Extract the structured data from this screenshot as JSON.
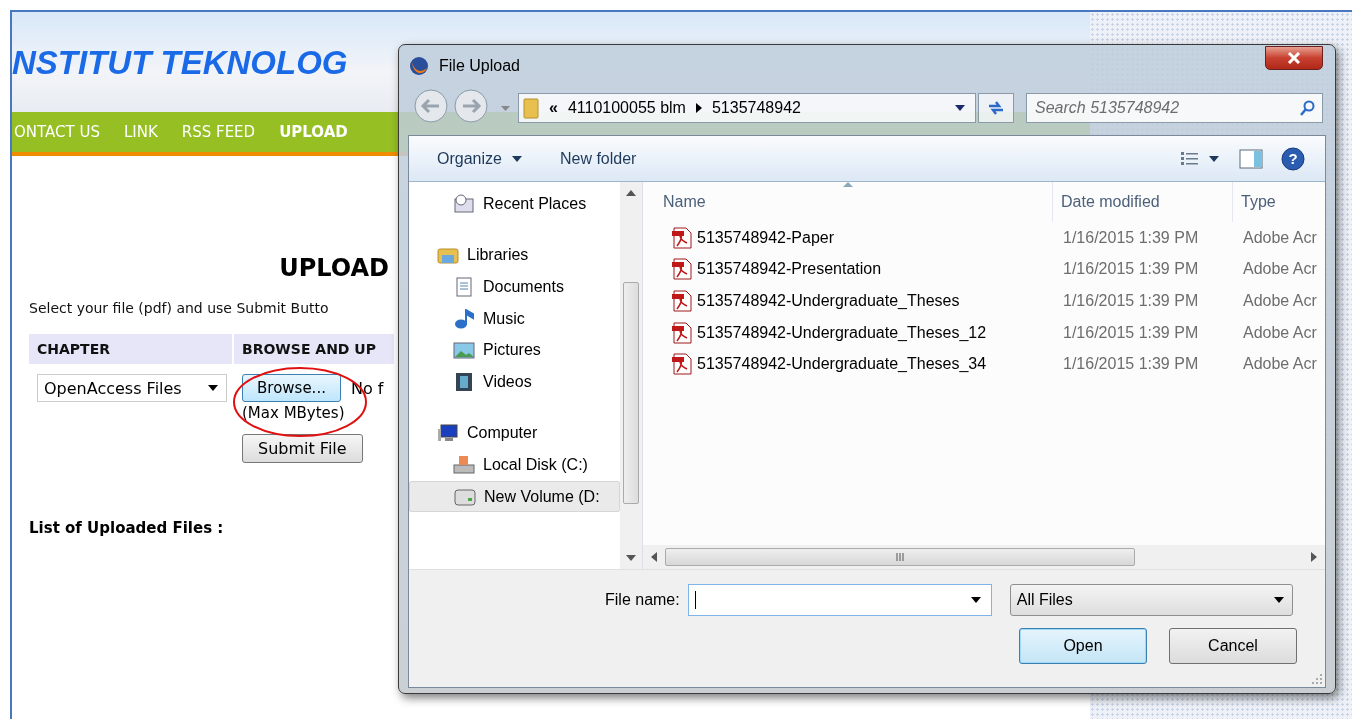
{
  "site": {
    "subtitle": "NSTITUT TEKNOLOG",
    "nav": [
      {
        "label": "ONTACT US",
        "selected": false
      },
      {
        "label": "LINK",
        "selected": false
      },
      {
        "label": "RSS FEED",
        "selected": false
      },
      {
        "label": "UPLOAD",
        "selected": true
      }
    ]
  },
  "upload_form": {
    "title": "UPLOAD",
    "instruction": "Select your file (pdf) and use Submit Butto",
    "columns": [
      "CHAPTER",
      "BROWSE AND UP"
    ],
    "chapter_select": "OpenAccess Files",
    "browse_button": "Browse...",
    "file_status": "No f",
    "size_note": "(Max MBytes)",
    "submit_button": "Submit File",
    "list_heading": "List of Uploaded Files :"
  },
  "dialog": {
    "title": "File Upload",
    "breadcrumb_prefix": "«",
    "breadcrumb": [
      "4110100055 blm",
      "5135748942"
    ],
    "search": {
      "placeholder": "Search 5135748942"
    },
    "toolbar": [
      {
        "label": "Organize",
        "kind": "menu"
      },
      {
        "label": "New folder",
        "kind": "button"
      }
    ],
    "help_glyph": "?",
    "nav_pane": [
      {
        "label": "Recent Places",
        "kind": "recent",
        "selected": false
      },
      {
        "label": "Libraries",
        "kind": "library",
        "selected": false,
        "children": [
          {
            "label": "Documents",
            "kind": "documents",
            "selected": false
          },
          {
            "label": "Music",
            "kind": "music",
            "selected": false
          },
          {
            "label": "Pictures",
            "kind": "pictures",
            "selected": false
          },
          {
            "label": "Videos",
            "kind": "videos",
            "selected": false
          }
        ]
      },
      {
        "label": "Computer",
        "kind": "computer",
        "selected": false,
        "children": [
          {
            "label": "Local Disk (C:)",
            "kind": "disk",
            "selected": false
          },
          {
            "label": "New Volume (D:",
            "kind": "drive",
            "selected": true
          }
        ]
      }
    ],
    "file_list": {
      "columns": [
        "Name",
        "Date modified",
        "Type"
      ],
      "rows": [
        {
          "name": "5135748942-Paper",
          "date": "1/16/2015 1:39 PM",
          "type": "Adobe Acr",
          "selected": false
        },
        {
          "name": "5135748942-Presentation",
          "date": "1/16/2015 1:39 PM",
          "type": "Adobe Acr",
          "selected": false
        },
        {
          "name": "5135748942-Undergraduate_Theses",
          "date": "1/16/2015 1:39 PM",
          "type": "Adobe Acr",
          "selected": false
        },
        {
          "name": "5135748942-Undergraduate_Theses_12",
          "date": "1/16/2015 1:39 PM",
          "type": "Adobe Acr",
          "selected": false
        },
        {
          "name": "5135748942-Undergraduate_Theses_34",
          "date": "1/16/2015 1:39 PM",
          "type": "Adobe Acr",
          "selected": false
        }
      ]
    },
    "file_name_label": "File name:",
    "file_type_filter": "All Files",
    "buttons": [
      {
        "label": "Open",
        "default": true
      },
      {
        "label": "Cancel",
        "default": false
      }
    ]
  }
}
